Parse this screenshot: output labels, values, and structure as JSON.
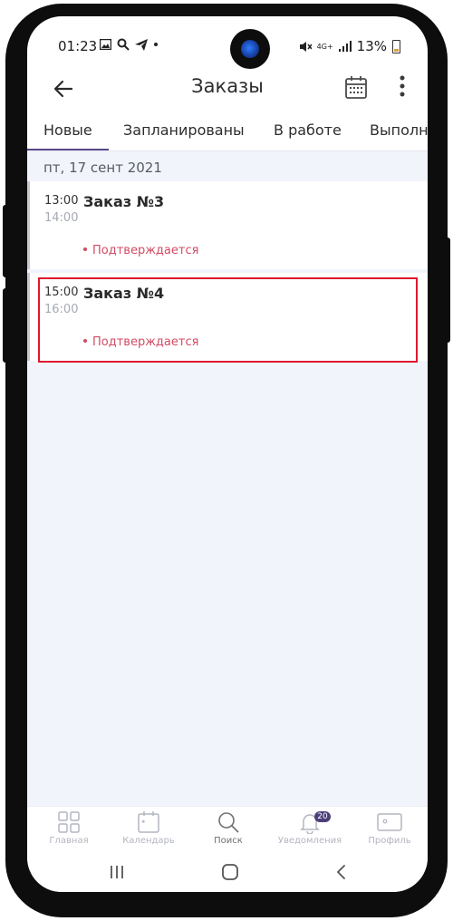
{
  "status_bar": {
    "time": "01:23",
    "network": "4G+",
    "battery": "13%"
  },
  "header": {
    "title": "Заказы",
    "back_icon": "arrow-left-icon",
    "calendar_icon": "calendar-icon",
    "more_icon": "more-vertical-icon"
  },
  "tabs": [
    {
      "label": "Новые",
      "active": true
    },
    {
      "label": "Запланированы",
      "active": false
    },
    {
      "label": "В работе",
      "active": false
    },
    {
      "label": "Выполнено",
      "active": false
    }
  ],
  "date_group": "пт, 17 сент 2021",
  "orders": [
    {
      "time_start": "13:00",
      "time_end": "14:00",
      "title": "Заказ №3",
      "status": "Подтверждается"
    },
    {
      "time_start": "15:00",
      "time_end": "16:00",
      "title": "Заказ №4",
      "status": "Подтверждается"
    }
  ],
  "bottom_nav": [
    {
      "label": "Главная",
      "icon": "grid-icon",
      "active": false
    },
    {
      "label": "Календарь",
      "icon": "calendar-icon",
      "active": false
    },
    {
      "label": "Поиск",
      "icon": "search-icon",
      "active": true
    },
    {
      "label": "Уведомления",
      "icon": "bell-icon",
      "active": false,
      "badge": "20"
    },
    {
      "label": "Профиль",
      "icon": "id-card-icon",
      "active": false
    }
  ],
  "colors": {
    "accent": "#5b4a8a",
    "status": "#d24b64",
    "highlight": "#e0182d",
    "background": "#f2f4fb"
  }
}
